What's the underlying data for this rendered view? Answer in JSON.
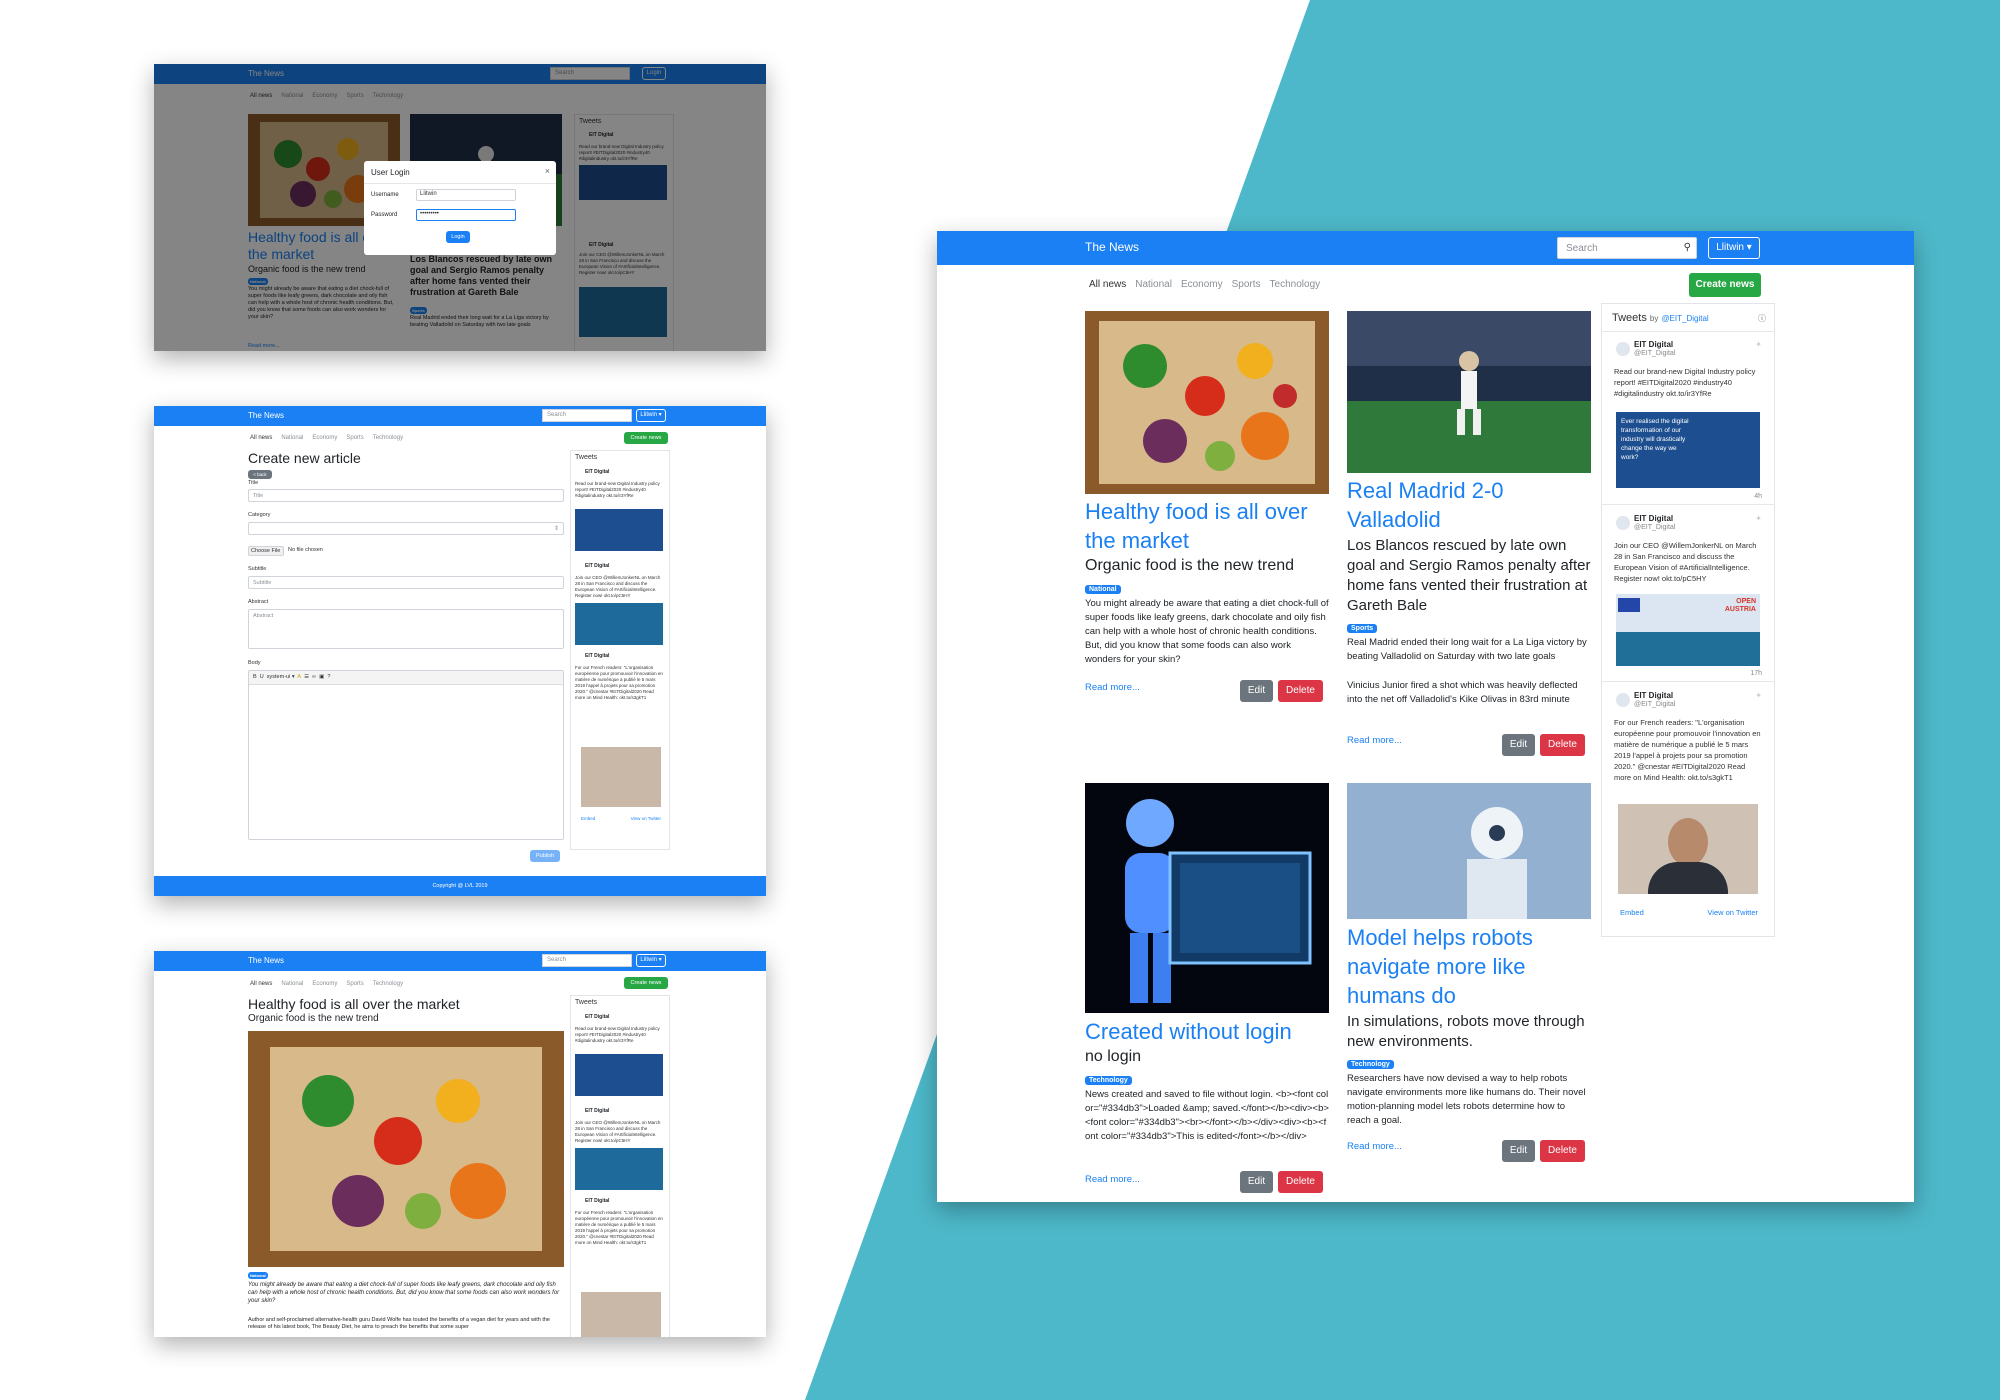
{
  "colors": {
    "teal": "#4db8c9",
    "primary": "#1a80f3",
    "success": "#28a745",
    "secondary": "#6c757d",
    "danger": "#dc3545"
  },
  "nav": {
    "brand": "The News",
    "search_placeholder": "Search",
    "user": "Llitwin",
    "login": "Login"
  },
  "categories": [
    "All news",
    "National",
    "Economy",
    "Sports",
    "Technology"
  ],
  "create_news": "Create news",
  "articles": [
    {
      "title": "Healthy food is all over the market",
      "subtitle": "Organic food is the new trend",
      "badge": "National",
      "abstract": "You might already be aware that eating a diet chock-full of super foods like leafy greens, dark chocolate and oily fish can help with a whole host of chronic health conditions. But, did you know that some foods can also work wonders for your skin?",
      "read_more": "Read more..."
    },
    {
      "title": "Real Madrid 2-0 Valladolid",
      "subtitle": "Los Blancos rescued by late own goal and Sergio Ramos penalty after home fans vented their frustration at Gareth Bale",
      "badge": "Sports",
      "abstract": "Real Madrid ended their long wait for a La Liga victory by beating Valladolid on Saturday with two late goals",
      "abstract2": "Vinicius Junior fired a shot which was heavily deflected into the net off Valladolid's Kike Olivas in 83rd minute",
      "read_more": "Read more..."
    },
    {
      "title": "Created without login",
      "subtitle": "no login",
      "badge": "Technology",
      "abstract": "News created and saved to file without login. <b><font color=\"#334db3\">Loaded &amp; saved.</font></b><div><b><font color=\"#334db3\"><br></font></b></div><div><b><font color=\"#334db3\">This is edited</font></b></div>",
      "read_more": "Read more..."
    },
    {
      "title": "Model helps robots navigate more like humans do",
      "subtitle": "In simulations, robots move through new environments.",
      "badge": "Technology",
      "abstract": "Researchers have now devised a way to help robots navigate environments more like humans do. Their novel motion-planning model lets robots determine how to reach a goal.",
      "read_more": "Read more..."
    }
  ],
  "actions": {
    "edit": "Edit",
    "delete": "Delete"
  },
  "tweets": {
    "header": "Tweets",
    "by": "by",
    "handle": "@EIT_Digital",
    "author": "EIT Digital",
    "author_handle": "@EIT_Digital",
    "items": [
      {
        "text": "Read our brand-new Digital Industry policy report! #EITDigital2020 #industry40 #digitalindustry okt.to/ir3YfRe",
        "card": "Ever realised the digital transformation of our industry will drastically change the way we work?",
        "time": "4h"
      },
      {
        "text": "Join our CEO @WillemJonkerNL on March 28 in San Francisco and discuss the European Vision of #ArtificialIntelligence. Register now! okt.to/pC5HY",
        "card": "OPEN AUSTRIA",
        "time": "17h"
      },
      {
        "text": "For our French readers: \"L'organisation européenne pour promouvoir l'innovation en matière de numérique a publié le 5 mars 2019 l'appel à projets pour sa promotion 2020.\" @cnestar #EITDigital2020 Read more on Mind Health: okt.to/s3gkT1",
        "card": "",
        "time": ""
      }
    ],
    "embed": "Embed",
    "view_on_twitter": "View on Twitter"
  },
  "login_modal": {
    "title": "User Login",
    "username_label": "Username",
    "username_value": "Llitwin",
    "password_label": "Password",
    "password_value": "•••••••••",
    "button": "Login"
  },
  "create_form": {
    "heading": "Create new article",
    "back": "< back",
    "title_label": "Title",
    "title_placeholder": "Title",
    "category_label": "Category",
    "choose_file": "Choose File",
    "no_file": "No file chosen",
    "subtitle_label": "Subtitle",
    "subtitle_placeholder": "Subtitle",
    "abstract_label": "Abstract",
    "abstract_placeholder": "Abstract",
    "body_label": "Body",
    "font_name": "system-ui",
    "publish": "Publish"
  },
  "footer": "Copyright @ LVL 2019",
  "article_view": {
    "title": "Healthy food is all over the market",
    "subtitle": "Organic food is the new trend",
    "badge": "National",
    "lead": "You might already be aware that eating a diet chock-full of super foods like leafy greens, dark chocolate and oily fish can help with a whole host of chronic health conditions. But, did you know that some foods can also work wonders for your skin?",
    "body": "Author and self-proclaimed alternative-health guru David Wolfe has touted the benefits of a vegan diet for years and with the release of his latest book, The Beauty Diet, he aims to preach the benefits that some super"
  }
}
